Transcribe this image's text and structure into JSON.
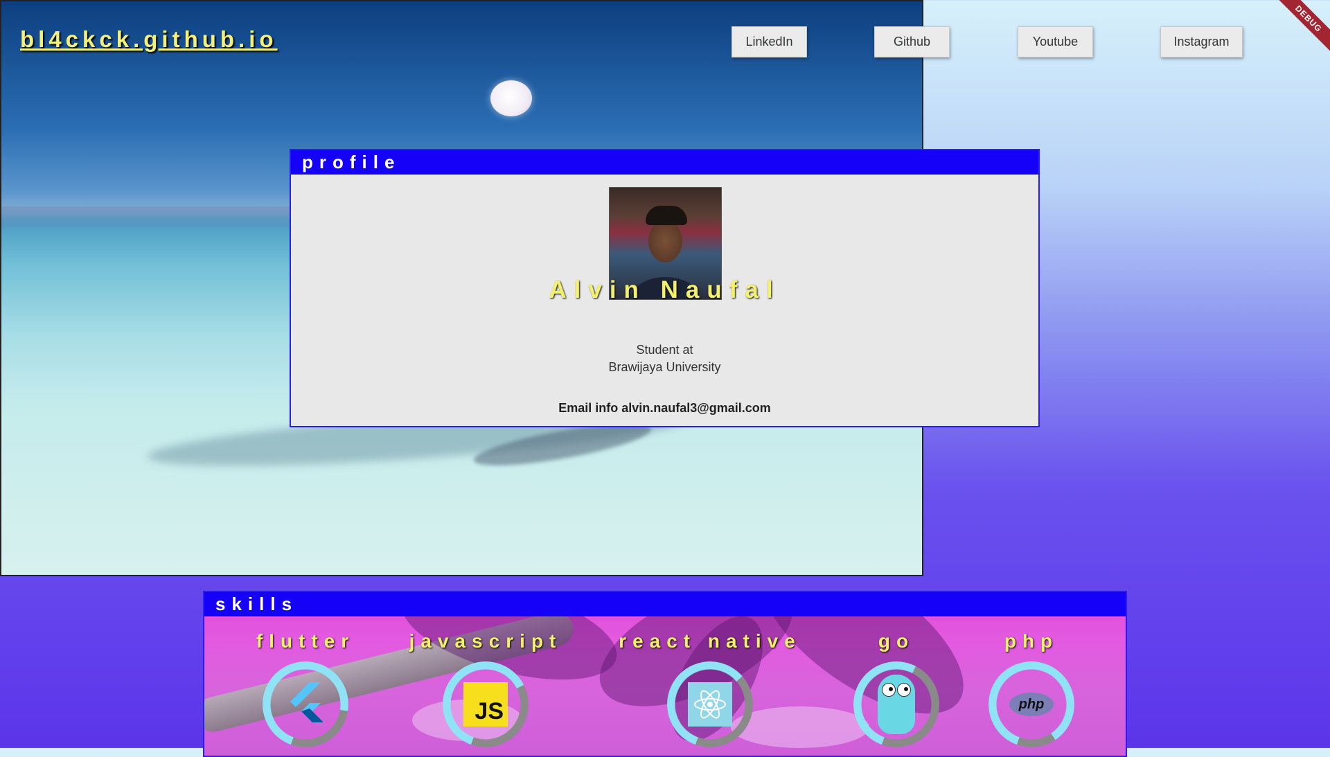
{
  "site": {
    "title": "bl4ckck.github.io"
  },
  "nav": [
    {
      "label": "LinkedIn"
    },
    {
      "label": "Github"
    },
    {
      "label": "Youtube"
    },
    {
      "label": "Instagram"
    }
  ],
  "debug_banner": "DEBUG",
  "profile": {
    "header": "profile",
    "name": "Alvin Naufal",
    "role_line1": "Student at",
    "role_line2": "Brawijaya University",
    "email": "Email info alvin.naufal3@gmail.com"
  },
  "skills": {
    "header": "skills",
    "items": [
      {
        "name": "flutter",
        "icon": "flutter-icon",
        "level": 0.72
      },
      {
        "name": "javascript",
        "icon": "js-icon",
        "level": 0.62
      },
      {
        "name": "react native",
        "icon": "react-icon",
        "level": 0.58
      },
      {
        "name": "go",
        "icon": "gopher-icon",
        "level": 0.52
      },
      {
        "name": "php",
        "icon": "php-icon",
        "level": 0.85
      }
    ]
  },
  "colors": {
    "accent_blue": "#1500f8",
    "title_yellow": "#f3f06e",
    "ring_fill": "#8fe3f5",
    "ring_track": "#8a8a8a",
    "debug_red": "#a32532"
  }
}
